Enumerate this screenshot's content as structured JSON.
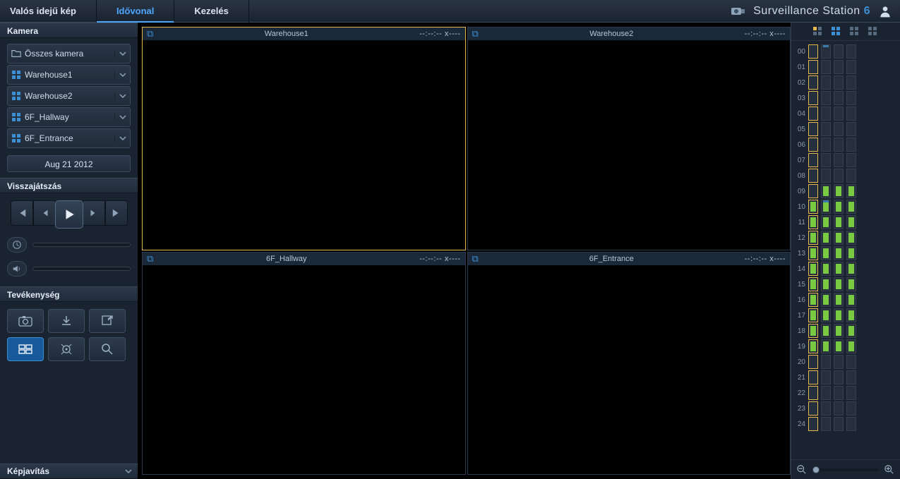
{
  "topbar": {
    "tabs": [
      "Valós idejű kép",
      "Idővonal",
      "Kezelés"
    ],
    "active_index": 1,
    "brand_prefix": "Surveillance Station",
    "brand_version": "6"
  },
  "camera_section": {
    "title": "Kamera",
    "items": [
      {
        "label": "Összes kamera",
        "icon": "folder"
      },
      {
        "label": "Warehouse1",
        "icon": "grid"
      },
      {
        "label": "Warehouse2",
        "icon": "grid"
      },
      {
        "label": "6F_Hallway",
        "icon": "grid"
      },
      {
        "label": "6F_Entrance",
        "icon": "grid"
      }
    ],
    "date": "Aug 21 2012"
  },
  "playback_section": {
    "title": "Visszajátszás"
  },
  "activity_section": {
    "title": "Tevékenység"
  },
  "enhance_section": {
    "title": "Képjavítás"
  },
  "views": [
    {
      "name": "Warehouse1",
      "time": "--:--:-- x----",
      "selected": true
    },
    {
      "name": "Warehouse2",
      "time": "--:--:-- x----",
      "selected": false
    },
    {
      "name": "6F_Hallway",
      "time": "--:--:-- x----",
      "selected": false
    },
    {
      "name": "6F_Entrance",
      "time": "--:--:-- x----",
      "selected": false
    }
  ],
  "timeline": {
    "hours": [
      "00",
      "01",
      "02",
      "03",
      "04",
      "05",
      "06",
      "07",
      "08",
      "09",
      "10",
      "11",
      "12",
      "13",
      "14",
      "15",
      "16",
      "17",
      "18",
      "19",
      "20",
      "21",
      "22",
      "23",
      "24"
    ],
    "tracks": 4
  }
}
